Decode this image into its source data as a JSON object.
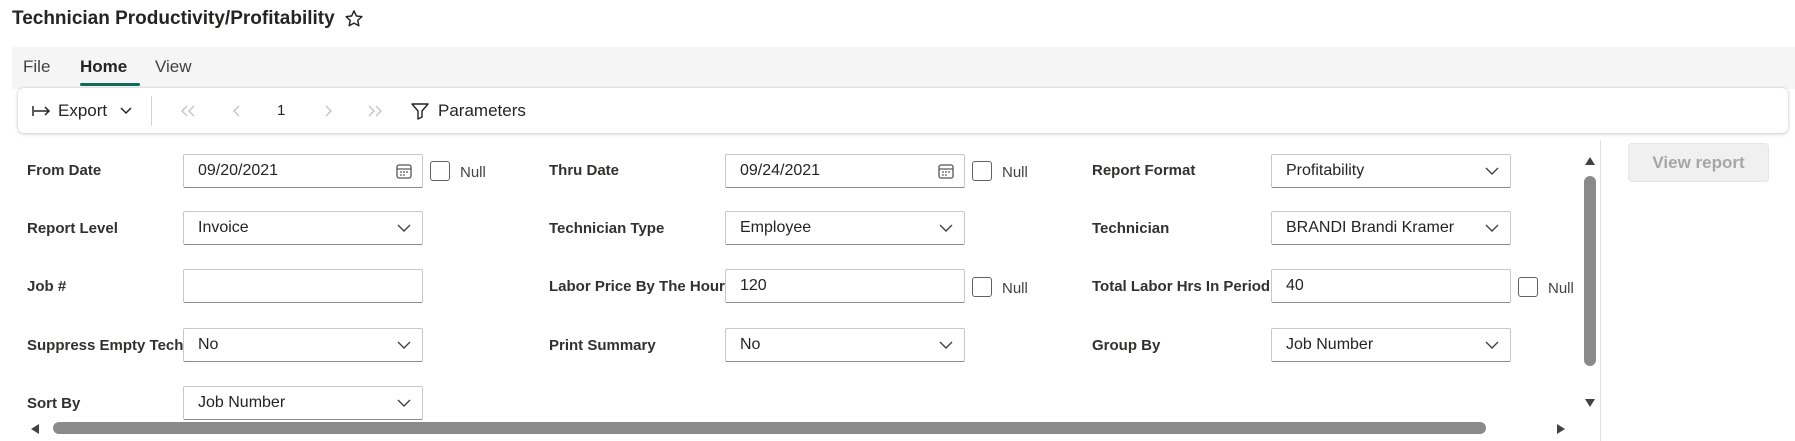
{
  "title": "Technician Productivity/Profitability",
  "ribbon": {
    "tabs": [
      "File",
      "Home",
      "View"
    ]
  },
  "toolbar": {
    "export_label": "Export",
    "page_number": "1",
    "parameters_label": "Parameters"
  },
  "params": {
    "from_date": {
      "label": "From Date",
      "value": "09/20/2021",
      "null_label": "Null"
    },
    "thru_date": {
      "label": "Thru Date",
      "value": "09/24/2021",
      "null_label": "Null"
    },
    "report_format": {
      "label": "Report Format",
      "value": "Profitability"
    },
    "report_level": {
      "label": "Report Level",
      "value": "Invoice"
    },
    "technician_type": {
      "label": "Technician Type",
      "value": "Employee"
    },
    "technician": {
      "label": "Technician",
      "value": "BRANDI Brandi Kramer"
    },
    "job_number": {
      "label": "Job #",
      "value": ""
    },
    "labor_price": {
      "label": "Labor Price By The Hour",
      "value": "120",
      "null_label": "Null"
    },
    "total_labor_hrs": {
      "label": "Total Labor Hrs In Period",
      "value": "40",
      "null_label": "Null"
    },
    "suppress_empty_tech": {
      "label": "Suppress Empty Tech",
      "value": "No"
    },
    "print_summary": {
      "label": "Print Summary",
      "value": "No"
    },
    "group_by": {
      "label": "Group By",
      "value": "Job Number"
    },
    "sort_by": {
      "label": "Sort By",
      "value": "Job Number"
    }
  },
  "view_report_label": "View report"
}
